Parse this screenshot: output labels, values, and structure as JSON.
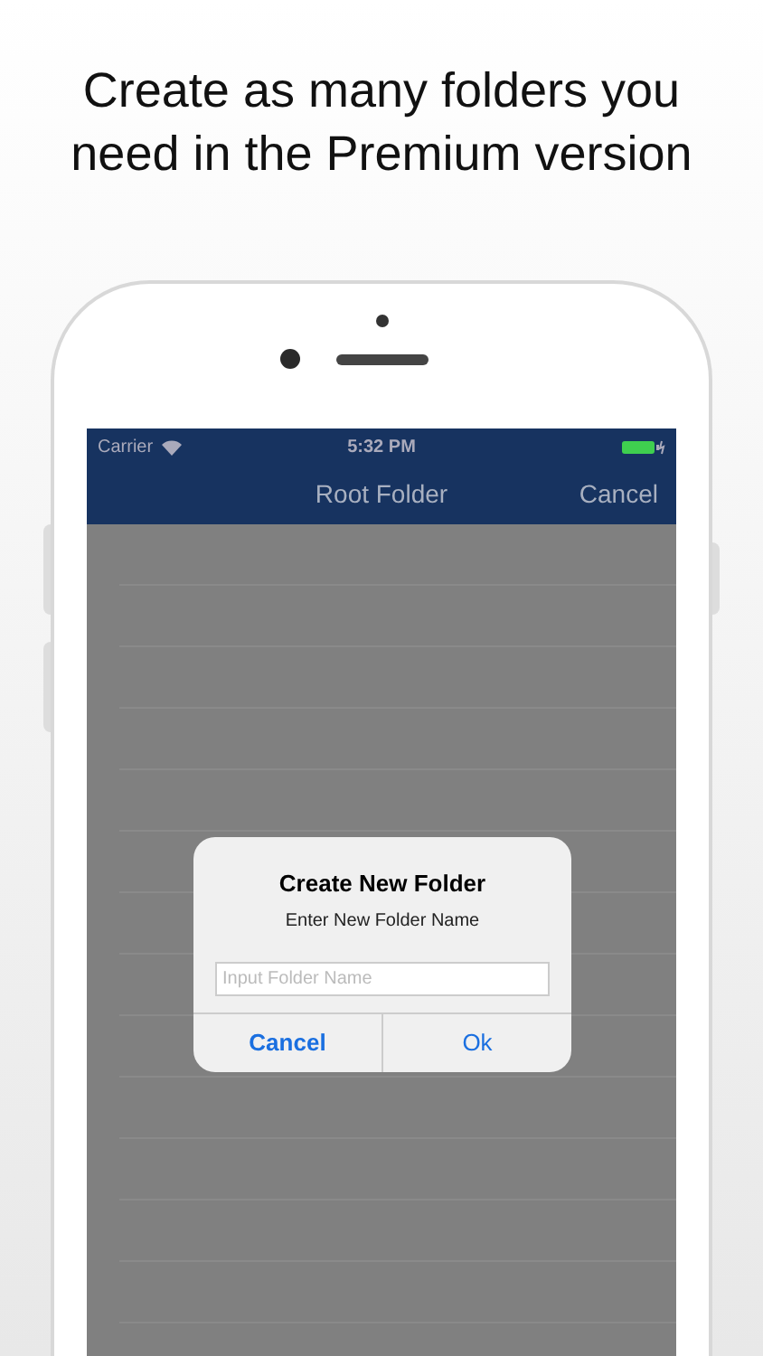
{
  "headline": "Create as many folders you need in the Premium version",
  "status_bar": {
    "carrier": "Carrier",
    "time": "5:32 PM"
  },
  "nav_bar": {
    "title": "Root Folder",
    "right_button": "Cancel"
  },
  "dialog": {
    "title": "Create New Folder",
    "message": "Enter New Folder Name",
    "field": {
      "placeholder": "Input Folder Name"
    },
    "buttons": [
      {
        "label": "Cancel",
        "bold": true
      },
      {
        "label": "Ok",
        "bold": false
      }
    ]
  }
}
